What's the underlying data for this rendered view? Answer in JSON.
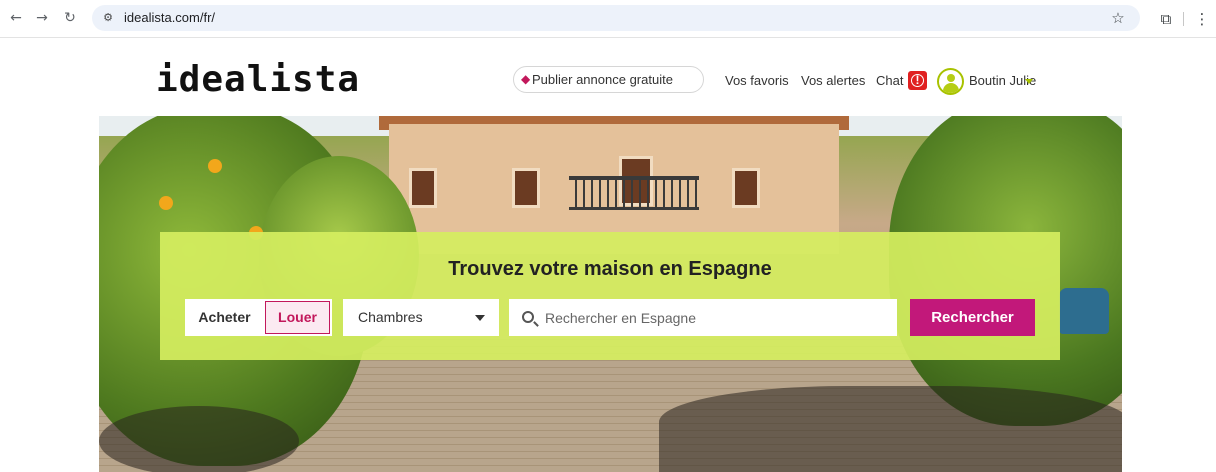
{
  "browser": {
    "url": "idealista.com/fr/",
    "icons": [
      "back-icon",
      "forward-icon",
      "reload-icon",
      "site-info-icon",
      "star-icon",
      "extensions-icon",
      "menu-icon"
    ]
  },
  "header": {
    "logo": "idealista",
    "publish_label": "Publier annonce gratuite",
    "favorites_label": "Vos favoris",
    "alerts_label": "Vos alertes",
    "chat_label": "Chat",
    "chat_badge": "!",
    "user_name": "Boutin Julie"
  },
  "search": {
    "title": "Trouvez votre maison en Espagne",
    "buy_label": "Acheter",
    "rent_label": "Louer",
    "rooms_label": "Chambres",
    "placeholder": "Rechercher en Espagne",
    "button_label": "Rechercher"
  },
  "colors": {
    "brand": "#c2187a",
    "panel": "#d5ee60",
    "accent_green": "#a8c200",
    "chat_badge": "#e02020"
  }
}
